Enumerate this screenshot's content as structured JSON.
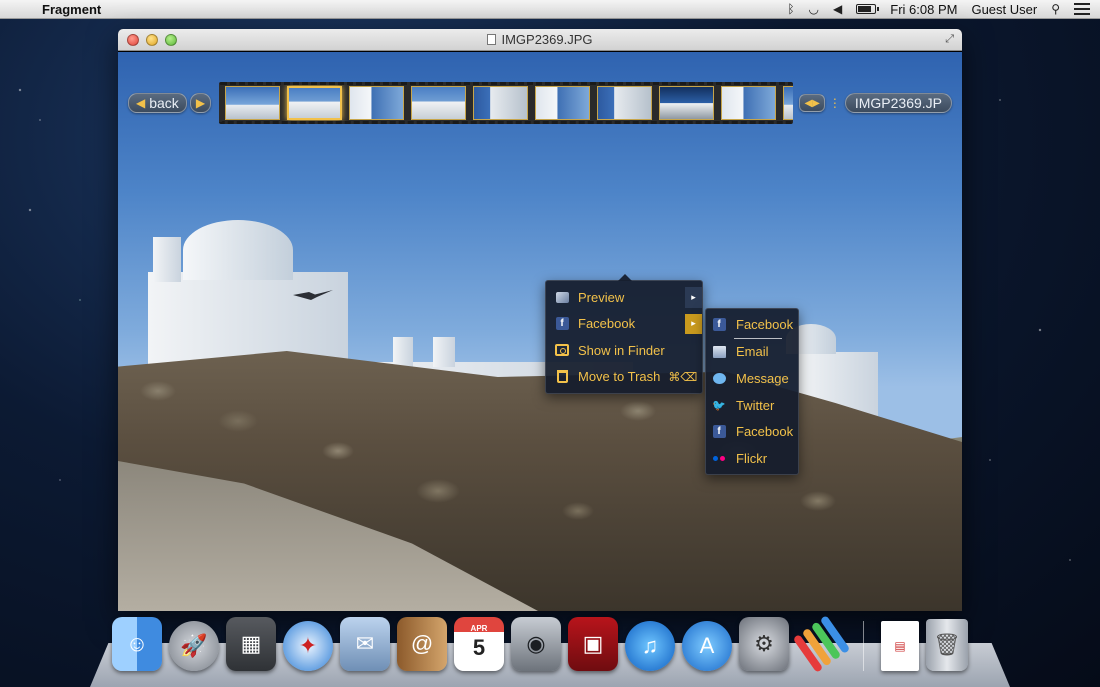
{
  "menubar": {
    "apple_icon": "apple-icon",
    "app_name": "Fragment",
    "clock": "Fri 6:08 PM",
    "user": "Guest User"
  },
  "window": {
    "title": "IMGP2369.JPG"
  },
  "filmstrip": {
    "back_label": "back",
    "filename": "IMGP2369.JP",
    "thumbnail_count": 10,
    "selected_index": 1
  },
  "context_menu": {
    "items": [
      {
        "label": "Preview",
        "icon": "preview-icon",
        "has_submenu": true
      },
      {
        "label": "Facebook",
        "icon": "facebook-icon",
        "has_submenu": true
      },
      {
        "label": "Show in Finder",
        "icon": "finder-icon",
        "has_submenu": false
      },
      {
        "label": "Move to Trash",
        "icon": "trash-icon",
        "shortcut": "⌘⌫"
      }
    ]
  },
  "submenu": {
    "items": [
      {
        "label": "Facebook",
        "icon": "facebook-icon"
      },
      {
        "label": "Email",
        "icon": "email-icon"
      },
      {
        "label": "Message",
        "icon": "message-icon"
      },
      {
        "label": "Twitter",
        "icon": "twitter-icon"
      },
      {
        "label": "Facebook",
        "icon": "facebook-icon"
      },
      {
        "label": "Flickr",
        "icon": "flickr-icon"
      }
    ]
  },
  "dock": {
    "calendar_month": "APR",
    "calendar_day": "5",
    "apps": [
      "Finder",
      "Launchpad",
      "iPhoto",
      "Safari",
      "Mail",
      "Contacts",
      "Calendar",
      "FaceTime",
      "Photo Booth",
      "iTunes",
      "App Store",
      "System Preferences",
      "Fragment",
      "Document",
      "Trash"
    ]
  },
  "colors": {
    "accent": "#f2c14a",
    "menu_bg": "#141c2c"
  }
}
